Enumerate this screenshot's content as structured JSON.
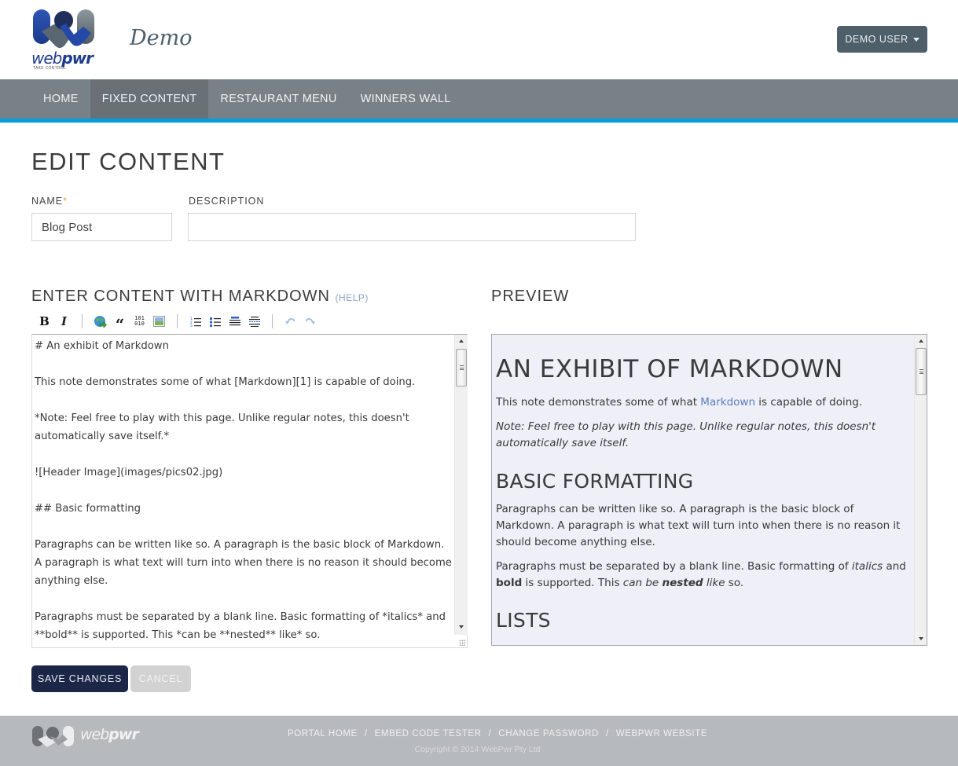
{
  "header": {
    "logo_word_light": "web",
    "logo_word_bold": "pwr",
    "logo_tagline": "TAKE CONTROL",
    "site_title": "Demo",
    "user_menu_label": "DEMO USER"
  },
  "nav": {
    "items": [
      {
        "label": "HOME",
        "active": false
      },
      {
        "label": "FIXED CONTENT",
        "active": true
      },
      {
        "label": "RESTAURANT MENU",
        "active": false
      },
      {
        "label": "WINNERS WALL",
        "active": false
      }
    ]
  },
  "colors": {
    "nav_bg": "#788187",
    "nav_active": "#697177",
    "accent_bar": "#029ee0",
    "primary_button": "#1c2748",
    "required_star": "#f3a230",
    "preview_bg": "#eeeff7",
    "link": "#5b7fbf"
  },
  "form": {
    "title": "EDIT CONTENT",
    "name_label": "NAME",
    "name_required": "*",
    "name_value": "Blog Post",
    "description_label": "DESCRIPTION",
    "description_value": ""
  },
  "editor": {
    "heading": "ENTER CONTENT WITH MARKDOWN",
    "help_label": "(HELP)",
    "toolbar": [
      {
        "name": "bold",
        "glyph": "B"
      },
      {
        "name": "italic",
        "glyph": "I"
      },
      {
        "name": "link",
        "glyph": "globe"
      },
      {
        "name": "quote",
        "glyph": "“"
      },
      {
        "name": "code",
        "glyph": "101\n010"
      },
      {
        "name": "image",
        "glyph": "image"
      },
      {
        "name": "ordered-list",
        "glyph": "ol"
      },
      {
        "name": "unordered-list",
        "glyph": "ul"
      },
      {
        "name": "heading",
        "glyph": "heading"
      },
      {
        "name": "horizontal-rule",
        "glyph": "hr"
      },
      {
        "name": "undo",
        "glyph": "↶"
      },
      {
        "name": "redo",
        "glyph": "↷"
      }
    ],
    "content": "# An exhibit of Markdown\n\nThis note demonstrates some of what [Markdown][1] is capable of doing.\n\n*Note: Feel free to play with this page. Unlike regular notes, this doesn't automatically save itself.*\n\n![Header Image](images/pics02.jpg)\n\n## Basic formatting\n\nParagraphs can be written like so. A paragraph is the basic block of Markdown. A paragraph is what text will turn into when there is no reason it should become anything else.\n\nParagraphs must be separated by a blank line. Basic formatting of *italics* and **bold** is supported. This *can be **nested** like* so."
  },
  "preview": {
    "heading": "PREVIEW",
    "h1": "AN EXHIBIT OF MARKDOWN",
    "p1_before": "This note demonstrates some of what ",
    "p1_link": "Markdown",
    "p1_after": " is capable of doing.",
    "p2": "Note: Feel free to play with this page. Unlike regular notes, this doesn't automatically save itself.",
    "h2_basic": "BASIC FORMATTING",
    "p3": "Paragraphs can be written like so. A paragraph is the basic block of Markdown. A paragraph is what text will turn into when there is no reason it should become anything else.",
    "p4_a": "Paragraphs must be separated by a blank line. Basic formatting of ",
    "p4_italics": "italics",
    "p4_b": " and ",
    "p4_bold": "bold",
    "p4_c": " is supported. This ",
    "p4_can_be": "can be ",
    "p4_nested": "nested",
    "p4_like": " like",
    "p4_d": " so.",
    "h2_lists": "LISTS"
  },
  "actions": {
    "save_label": "SAVE CHANGES",
    "cancel_label": "CANCEL"
  },
  "footer": {
    "logo_word_light": "web",
    "logo_word_bold": "pwr",
    "links": [
      "PORTAL HOME",
      "EMBED CODE TESTER",
      "CHANGE PASSWORD",
      "WEBPWR WEBSITE"
    ],
    "separator": "/",
    "copyright": "Copyright © 2014 WebPwr Pty Ltd"
  }
}
